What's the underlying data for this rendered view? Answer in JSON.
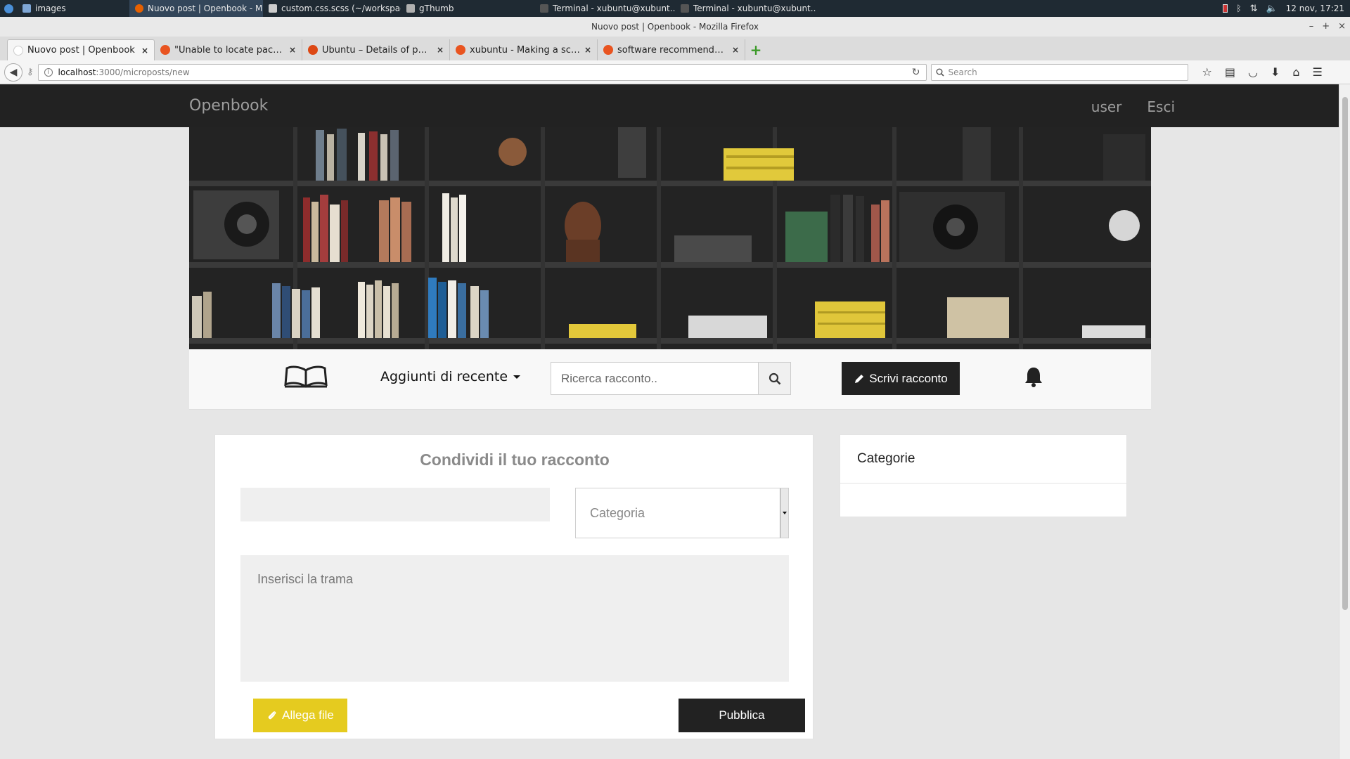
{
  "system_panel": {
    "tasks": [
      {
        "label": "images",
        "color": "#7fa7d6"
      },
      {
        "label": "Nuovo post | Openbook - M...",
        "color": "#e66000",
        "active": true
      },
      {
        "label": "custom.css.scss (~/workspac...",
        "color": "#cccccc"
      },
      {
        "label": "gThumb",
        "color": "#b0b0b0"
      },
      {
        "label": "Terminal - xubuntu@xubunt...",
        "color": "#333333"
      },
      {
        "label": "Terminal - xubuntu@xubunt...",
        "color": "#333333"
      }
    ],
    "clock": "12 nov, 17:21"
  },
  "window": {
    "title": "Nuovo post | Openbook - Mozilla Firefox",
    "controls": [
      "–",
      "+",
      "×"
    ]
  },
  "browser": {
    "tabs": [
      {
        "label": "Nuovo post | Openbook",
        "active": true,
        "favicon_color": "#ffffff"
      },
      {
        "label": "\"Unable to locate packag...",
        "favicon_color": "#e95420"
      },
      {
        "label": "Ubuntu – Details of packa...",
        "favicon_color": "#dd4814"
      },
      {
        "label": "xubuntu - Making a scree...",
        "favicon_color": "#e95420"
      },
      {
        "label": "software recommendatio...",
        "favicon_color": "#e95420"
      }
    ],
    "tab_close": "×",
    "new_tab": "+",
    "url_host": "localhost",
    "url_path": ":3000/microposts/new",
    "search_placeholder": "Search"
  },
  "site": {
    "brand": "Openbook",
    "nav": {
      "user": "user",
      "logout": "Esci"
    },
    "toolbar": {
      "dropdown_label": "Aggiunti di recente",
      "search_placeholder": "Ricerca racconto..",
      "write_button": "Scrivi racconto"
    },
    "form": {
      "heading": "Condividi il tuo racconto",
      "category_placeholder": "Categoria",
      "plot_placeholder": "Inserisci la trama",
      "attach_button": "Allega file",
      "publish_button": "Pubblica"
    },
    "sidebar": {
      "heading": "Categorie"
    }
  },
  "colors": {
    "navbar": "#222222",
    "accent_yellow": "#e5cb1f",
    "button_dark": "#222222"
  }
}
